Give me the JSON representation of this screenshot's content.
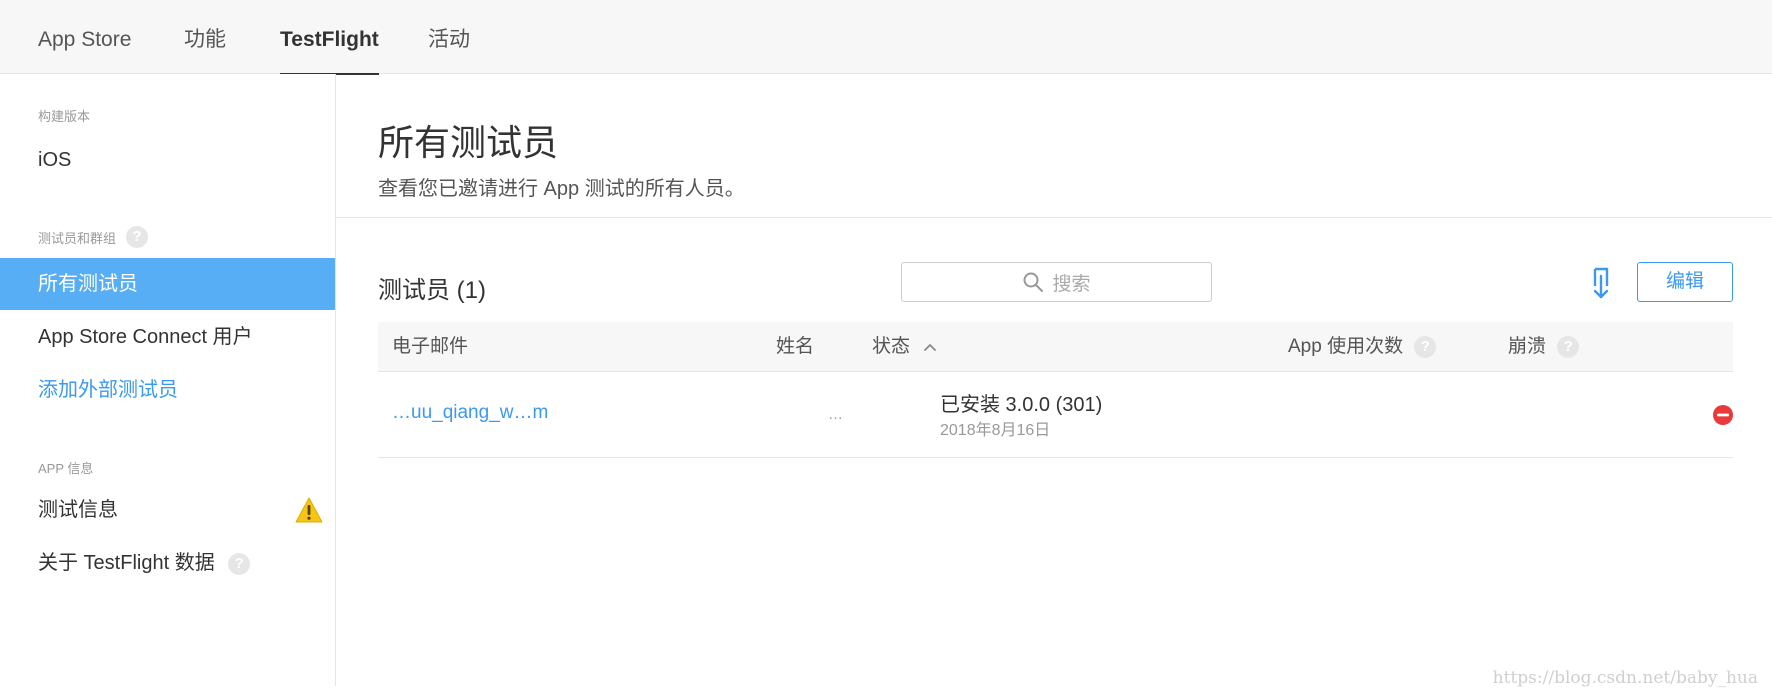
{
  "topnav": {
    "tabs": [
      {
        "label": "App Store"
      },
      {
        "label": "功能"
      },
      {
        "label": "TestFlight"
      },
      {
        "label": "活动"
      }
    ]
  },
  "sidebar": {
    "sections": [
      {
        "title": "构建版本",
        "items": [
          {
            "label": "iOS"
          }
        ]
      },
      {
        "title": "测试员和群组",
        "help": "?",
        "items": [
          {
            "label": "所有测试员"
          },
          {
            "label": "App Store Connect 用户"
          },
          {
            "label": "添加外部测试员"
          }
        ]
      },
      {
        "title": "APP 信息",
        "items": [
          {
            "label": "测试信息"
          },
          {
            "label": "关于 TestFlight 数据",
            "help": "?"
          }
        ]
      }
    ]
  },
  "main": {
    "title": "所有测试员",
    "subtitle": "查看您已邀请进行 App 测试的所有人员。",
    "list_title": "测试员 (1)",
    "search_placeholder": "搜索",
    "edit_label": "编辑",
    "columns": [
      {
        "label": "电子邮件"
      },
      {
        "label": "姓名"
      },
      {
        "label": "状态"
      },
      {
        "label": "App 使用次数",
        "help": "?"
      },
      {
        "label": "崩溃",
        "help": "?"
      }
    ],
    "rows": [
      {
        "email": "…uu_qiang_w…m",
        "name": "…",
        "status": "已安装 3.0.0 (301)",
        "date": "2018年8月16日"
      }
    ]
  },
  "watermark": "https://blog.csdn.net/baby_hua",
  "colors": {
    "accent": "#3b99f0",
    "active_bg": "#58aef4",
    "warning": "#f5c518",
    "danger": "#e8393b"
  },
  "icons": {
    "warning": "warning-icon",
    "download": "download-icon",
    "search": "search-icon",
    "remove": "remove-icon",
    "sort": "chevron-up-icon"
  }
}
